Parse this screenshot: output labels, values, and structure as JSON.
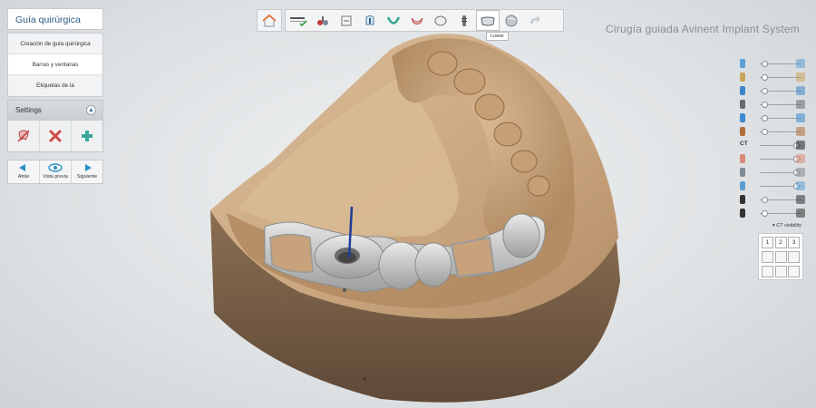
{
  "app": {
    "title": "Cirugía guiada Avinent Implant System"
  },
  "left_panel": {
    "header": "Guía quirúrgica",
    "items": [
      {
        "label": "Creación de guía quirúrgica"
      },
      {
        "label": "Barras y ventanas"
      },
      {
        "label": "Etiquetas de la"
      }
    ],
    "settings": {
      "title": "Settings",
      "tools": [
        {
          "icon": "remove-tooth-icon"
        },
        {
          "icon": "delete-x-icon"
        },
        {
          "icon": "add-plus-icon"
        }
      ]
    },
    "nav": [
      {
        "label": "Atrás",
        "icon": "arrow-left-icon"
      },
      {
        "label": "Vista previa",
        "icon": "eye-icon"
      },
      {
        "label": "Siguiente",
        "icon": "arrow-right-icon"
      }
    ]
  },
  "toolbar": {
    "home_icon": "home-icon",
    "tools": [
      {
        "name": "checklist-icon"
      },
      {
        "name": "tools-icon"
      },
      {
        "name": "layers-icon"
      },
      {
        "name": "tooth-section-icon"
      },
      {
        "name": "arch-icon"
      },
      {
        "name": "jaw-icon"
      },
      {
        "name": "tooth-icon"
      },
      {
        "name": "implant-icon"
      },
      {
        "name": "lower-jaw-icon"
      },
      {
        "name": "sphere-icon"
      },
      {
        "name": "redo-arrow-icon"
      }
    ],
    "tooltip": "Lower"
  },
  "right_panel": {
    "rows": [
      {
        "icon": "pin-icon",
        "value": 0.12
      },
      {
        "icon": "crown-icon",
        "value": 0.12
      },
      {
        "icon": "bridge-icon",
        "value": 0.12
      },
      {
        "icon": "implant-gray-icon",
        "value": 0.12
      },
      {
        "icon": "implant-blue-icon",
        "value": 0.12
      },
      {
        "icon": "abutment-icon",
        "value": 0.12
      },
      {
        "icon": "ct-icon",
        "label": "CT",
        "value": 0.88
      },
      {
        "icon": "jaw-upper-icon",
        "value": 0.88
      },
      {
        "icon": "tooth-outline-icon",
        "value": 0.88
      },
      {
        "icon": "wing-icon",
        "value": 0.88
      },
      {
        "icon": "brightness-icon",
        "value": 0.12
      },
      {
        "icon": "contrast-icon",
        "value": 0.12
      }
    ],
    "ct_visibility": "CT visibility",
    "views": [
      "1",
      "2",
      "3"
    ]
  },
  "colors": {
    "accent": "#2a8fc6",
    "model": "#c8a27a",
    "guide": "#c9cacb"
  }
}
